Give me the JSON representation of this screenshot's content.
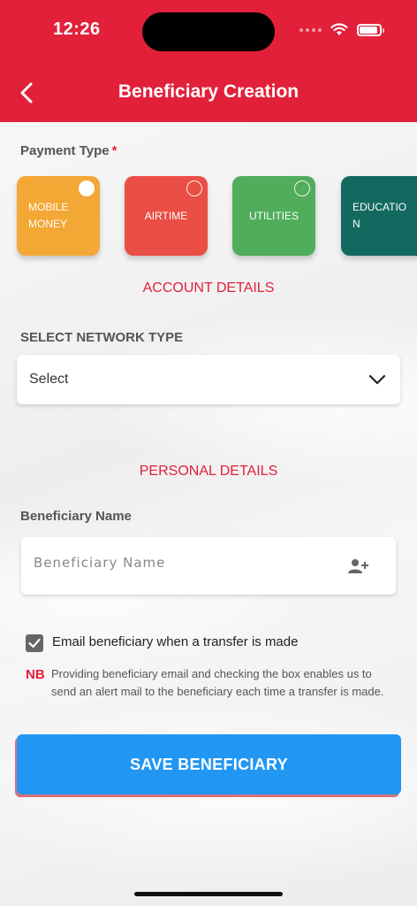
{
  "status_bar": {
    "time": "12:26"
  },
  "header": {
    "title": "Beneficiary Creation"
  },
  "payment_type": {
    "label": "Payment Type",
    "required_mark": "*",
    "options": [
      {
        "line1": "MOBILE",
        "line2": "MONEY",
        "selected": true,
        "color": "#f3a735"
      },
      {
        "label": "AIRTIME",
        "selected": false,
        "color": "#ea4e44"
      },
      {
        "label": "UTILITIES",
        "selected": false,
        "color": "#4fad5b"
      },
      {
        "line1": "EDUCATIO",
        "line2": "N",
        "selected": false,
        "color": "#13695f"
      }
    ]
  },
  "account_details": {
    "heading": "ACCOUNT DETAILS",
    "network_label": "SELECT NETWORK TYPE",
    "network_value": "Select"
  },
  "personal_details": {
    "heading": "PERSONAL DETAILS",
    "name_label": "Beneficiary Name",
    "name_placeholder": "Beneficiary Name"
  },
  "email_option": {
    "checked": true,
    "label": "Email beneficiary when a transfer is made",
    "nb_tag": "NB",
    "nb_text": "Providing beneficiary email and checking the box enables us to send an alert mail to the beneficiary each time a transfer is made."
  },
  "save_button": {
    "label": "SAVE BENEFICIARY",
    "color": "#2196f3"
  },
  "theme": {
    "accent": "#e2203a"
  }
}
